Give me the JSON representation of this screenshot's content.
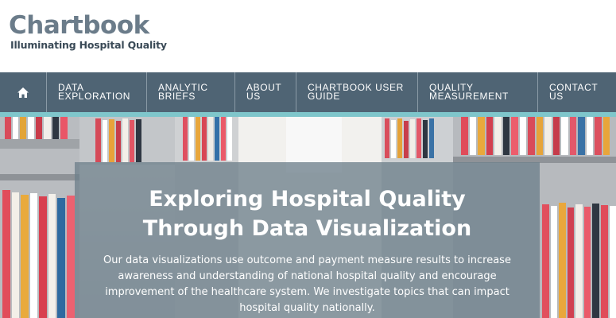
{
  "header": {
    "logo_title": "Chartbook",
    "logo_tagline": "Illuminating Hospital Quality"
  },
  "nav": {
    "home_icon": "home-icon",
    "items": [
      {
        "label": "DATA\nEXPLORATION"
      },
      {
        "label": "ANALYTIC\nBRIEFS"
      },
      {
        "label": "ABOUT\nUS"
      },
      {
        "label": "CHARTBOOK USER\nGUIDE"
      },
      {
        "label": "QUALITY\nMEASUREMENT"
      },
      {
        "label": "CONTACT\nUS"
      }
    ]
  },
  "hero": {
    "title_line1": "Exploring Hospital Quality",
    "title_line2": "Through Data Visualization",
    "body": "Our data visualizations use outcome and payment measure results to increase awareness and understanding of national hospital quality and encourage improvement of the healthcare system. We investigate topics that can impact hospital quality nationally."
  },
  "colors": {
    "nav_background": "#4f6474",
    "nav_accent": "#7fc6cb",
    "logo_title": "#6b7c8a",
    "logo_tagline": "#3a4a57",
    "hero_panel": "#6e808c"
  }
}
